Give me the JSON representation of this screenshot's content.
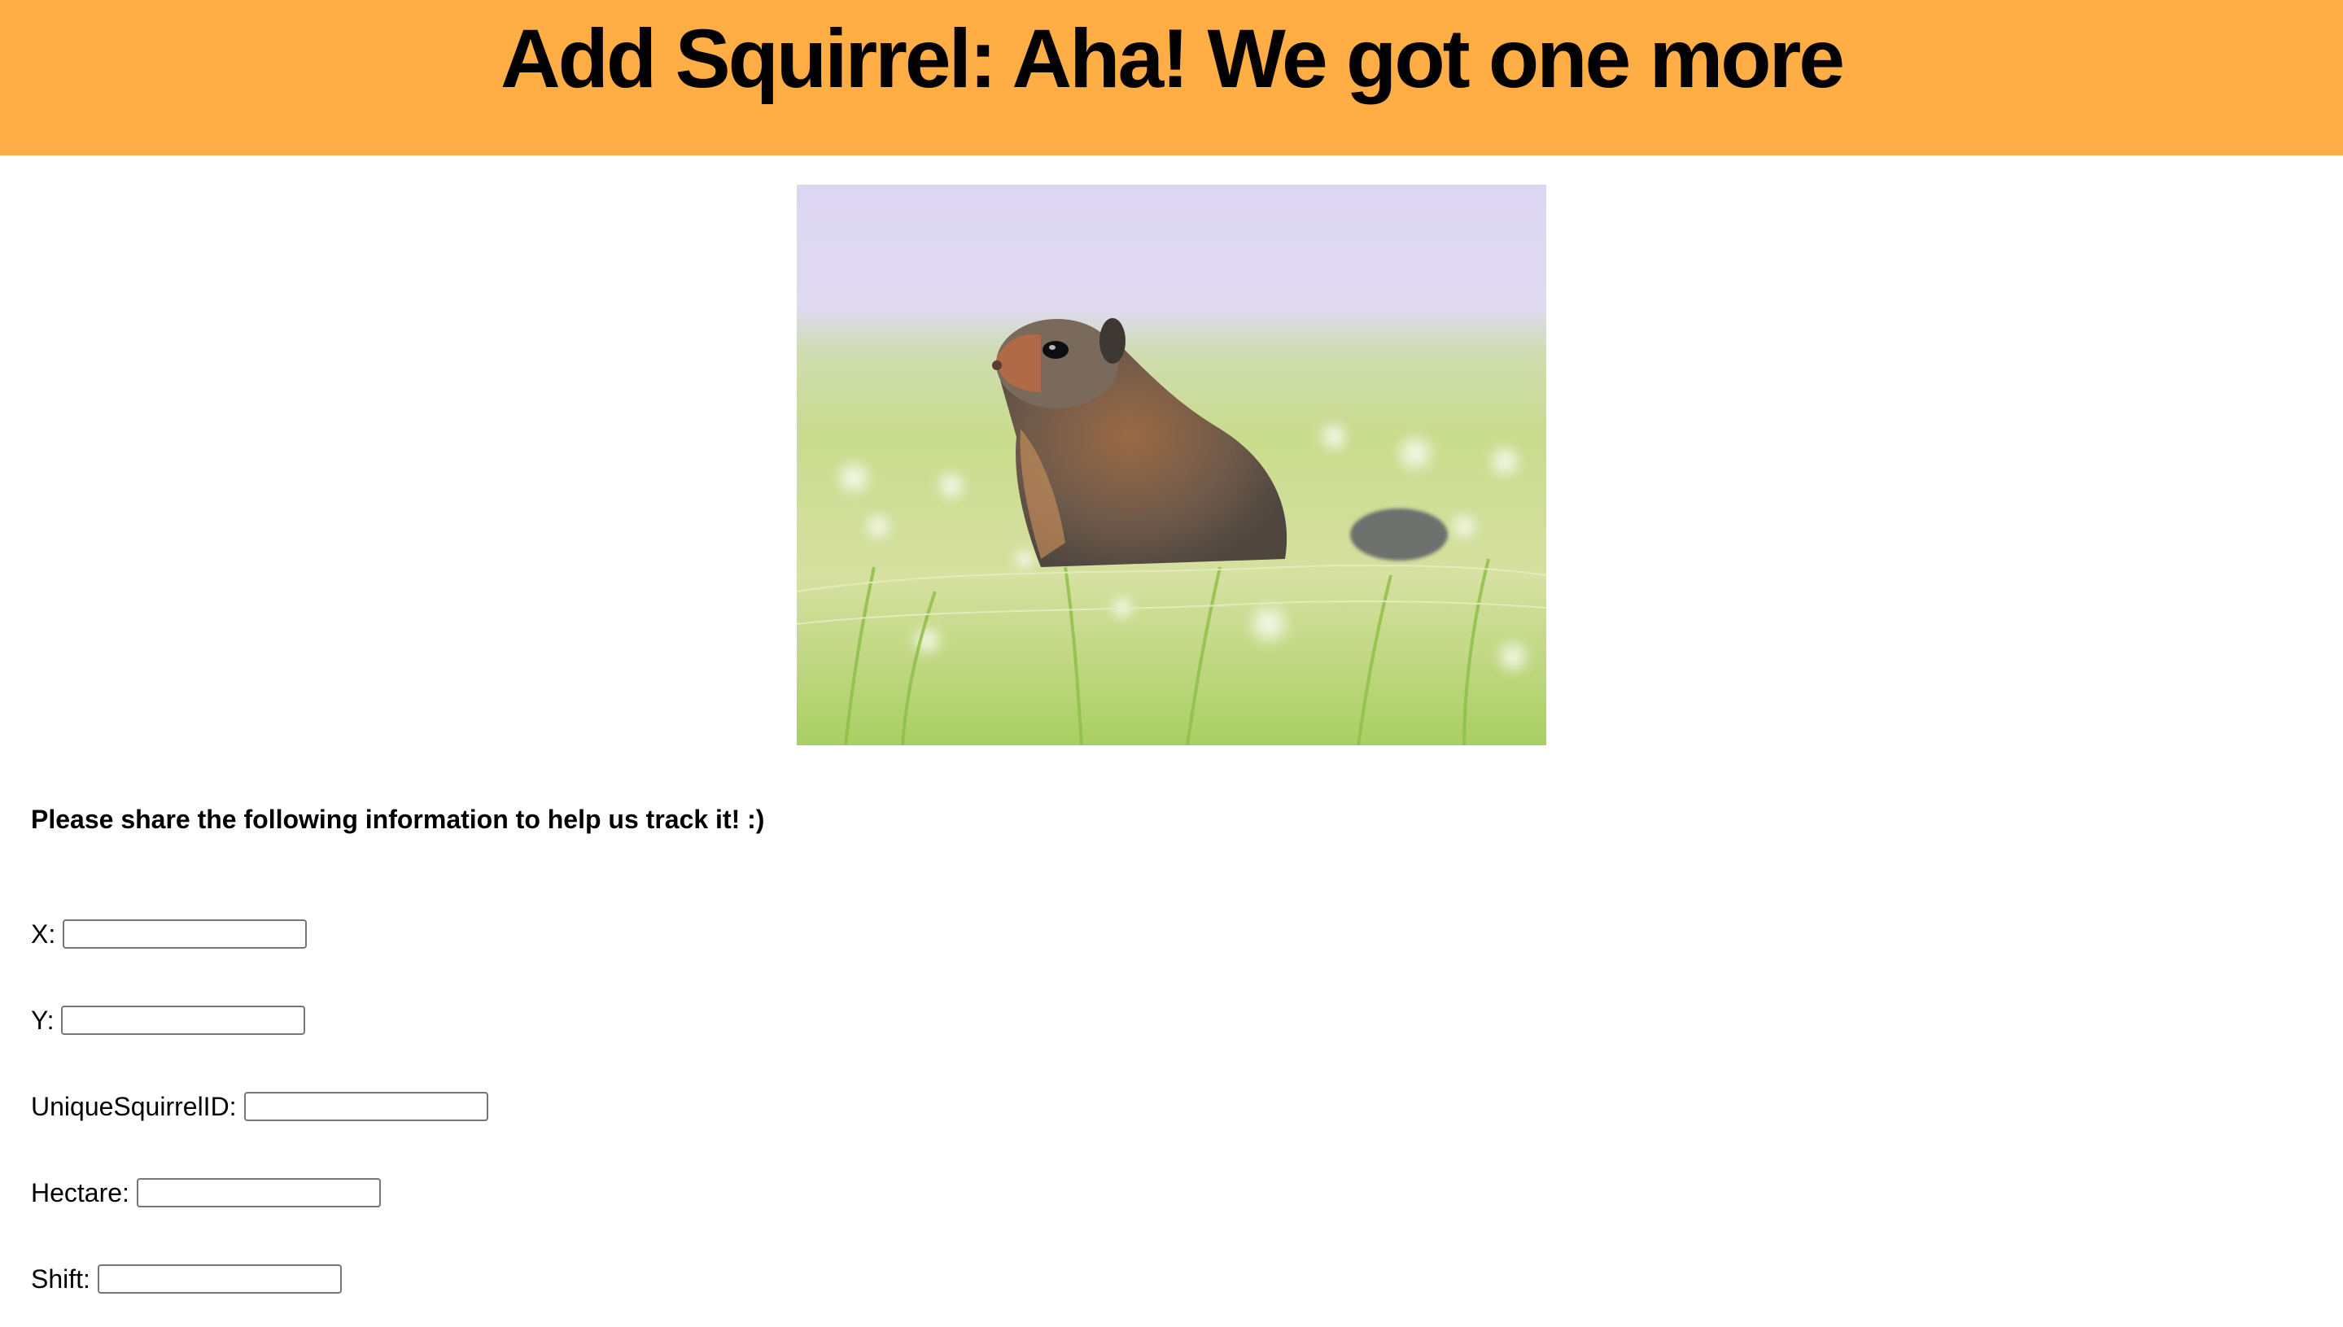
{
  "header": {
    "title": "Add Squirrel: Aha! We got one more",
    "background_color": "#FFAD45"
  },
  "image": {
    "subject": "squirrel-photo"
  },
  "form": {
    "prompt": "Please share the following information to help us track it! :)",
    "fields": [
      {
        "label": "X:",
        "value": "",
        "placeholder": ""
      },
      {
        "label": "Y:",
        "value": "",
        "placeholder": ""
      },
      {
        "label": "UniqueSquirrelID:",
        "value": "",
        "placeholder": ""
      },
      {
        "label": "Hectare:",
        "value": "",
        "placeholder": ""
      },
      {
        "label": "Shift:",
        "value": "",
        "placeholder": ""
      }
    ]
  }
}
